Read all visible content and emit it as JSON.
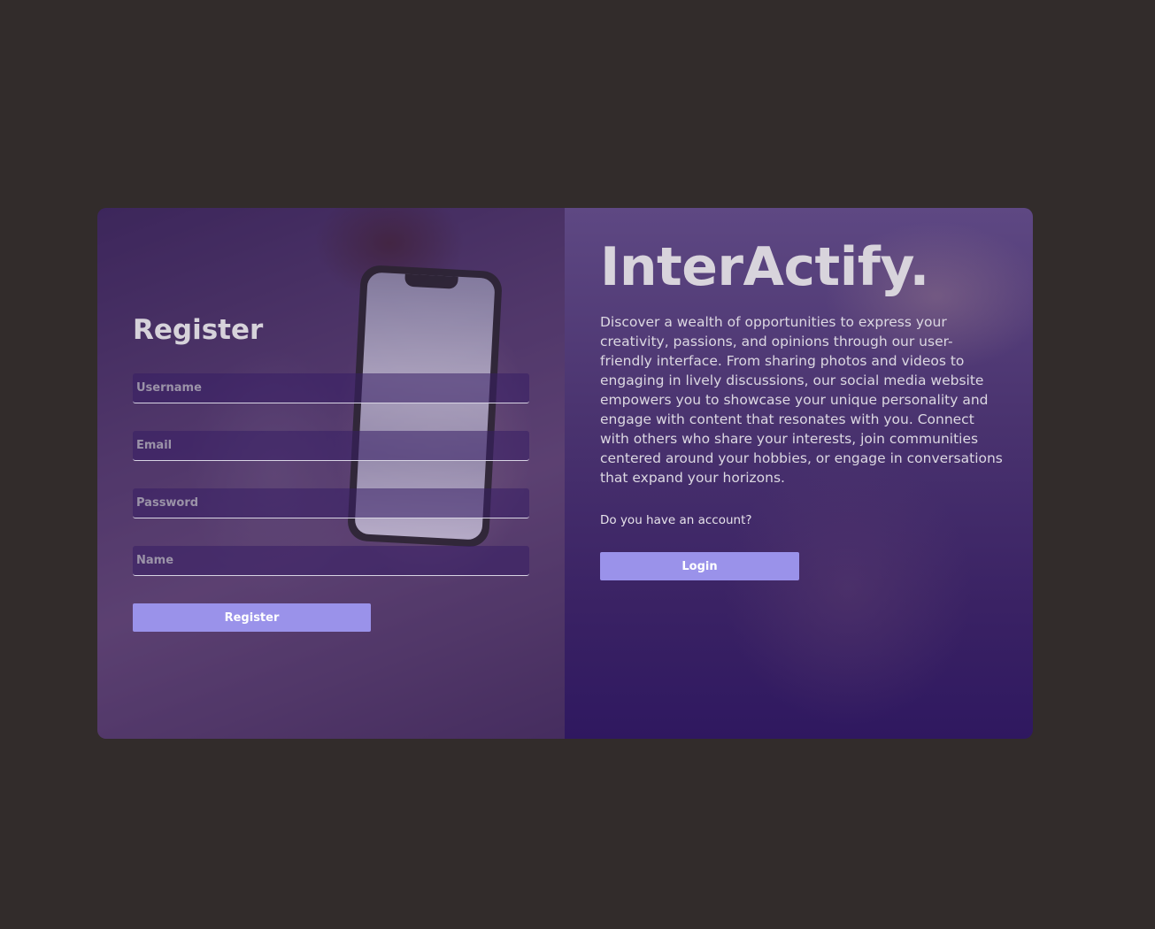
{
  "register": {
    "title": "Register",
    "username_placeholder": "Username",
    "email_placeholder": "Email",
    "password_placeholder": "Password",
    "name_placeholder": "Name",
    "submit_label": "Register"
  },
  "promo": {
    "brand": "InterActify.",
    "description": "Discover a wealth of opportunities to express your creativity, passions, and opinions through our user-friendly interface. From sharing photos and videos to engaging in lively discussions, our social media website empowers you to showcase your unique personality and engage with content that resonates with you. Connect with others who share your interests, join communities centered around your hobbies, or engage in conversations that expand your horizons.",
    "account_question": "Do you have an account?",
    "login_label": "Login"
  },
  "colors": {
    "page_background": "#322c2b",
    "button_accent": "#9a92ea",
    "overlay_purple": "#3a2264"
  }
}
